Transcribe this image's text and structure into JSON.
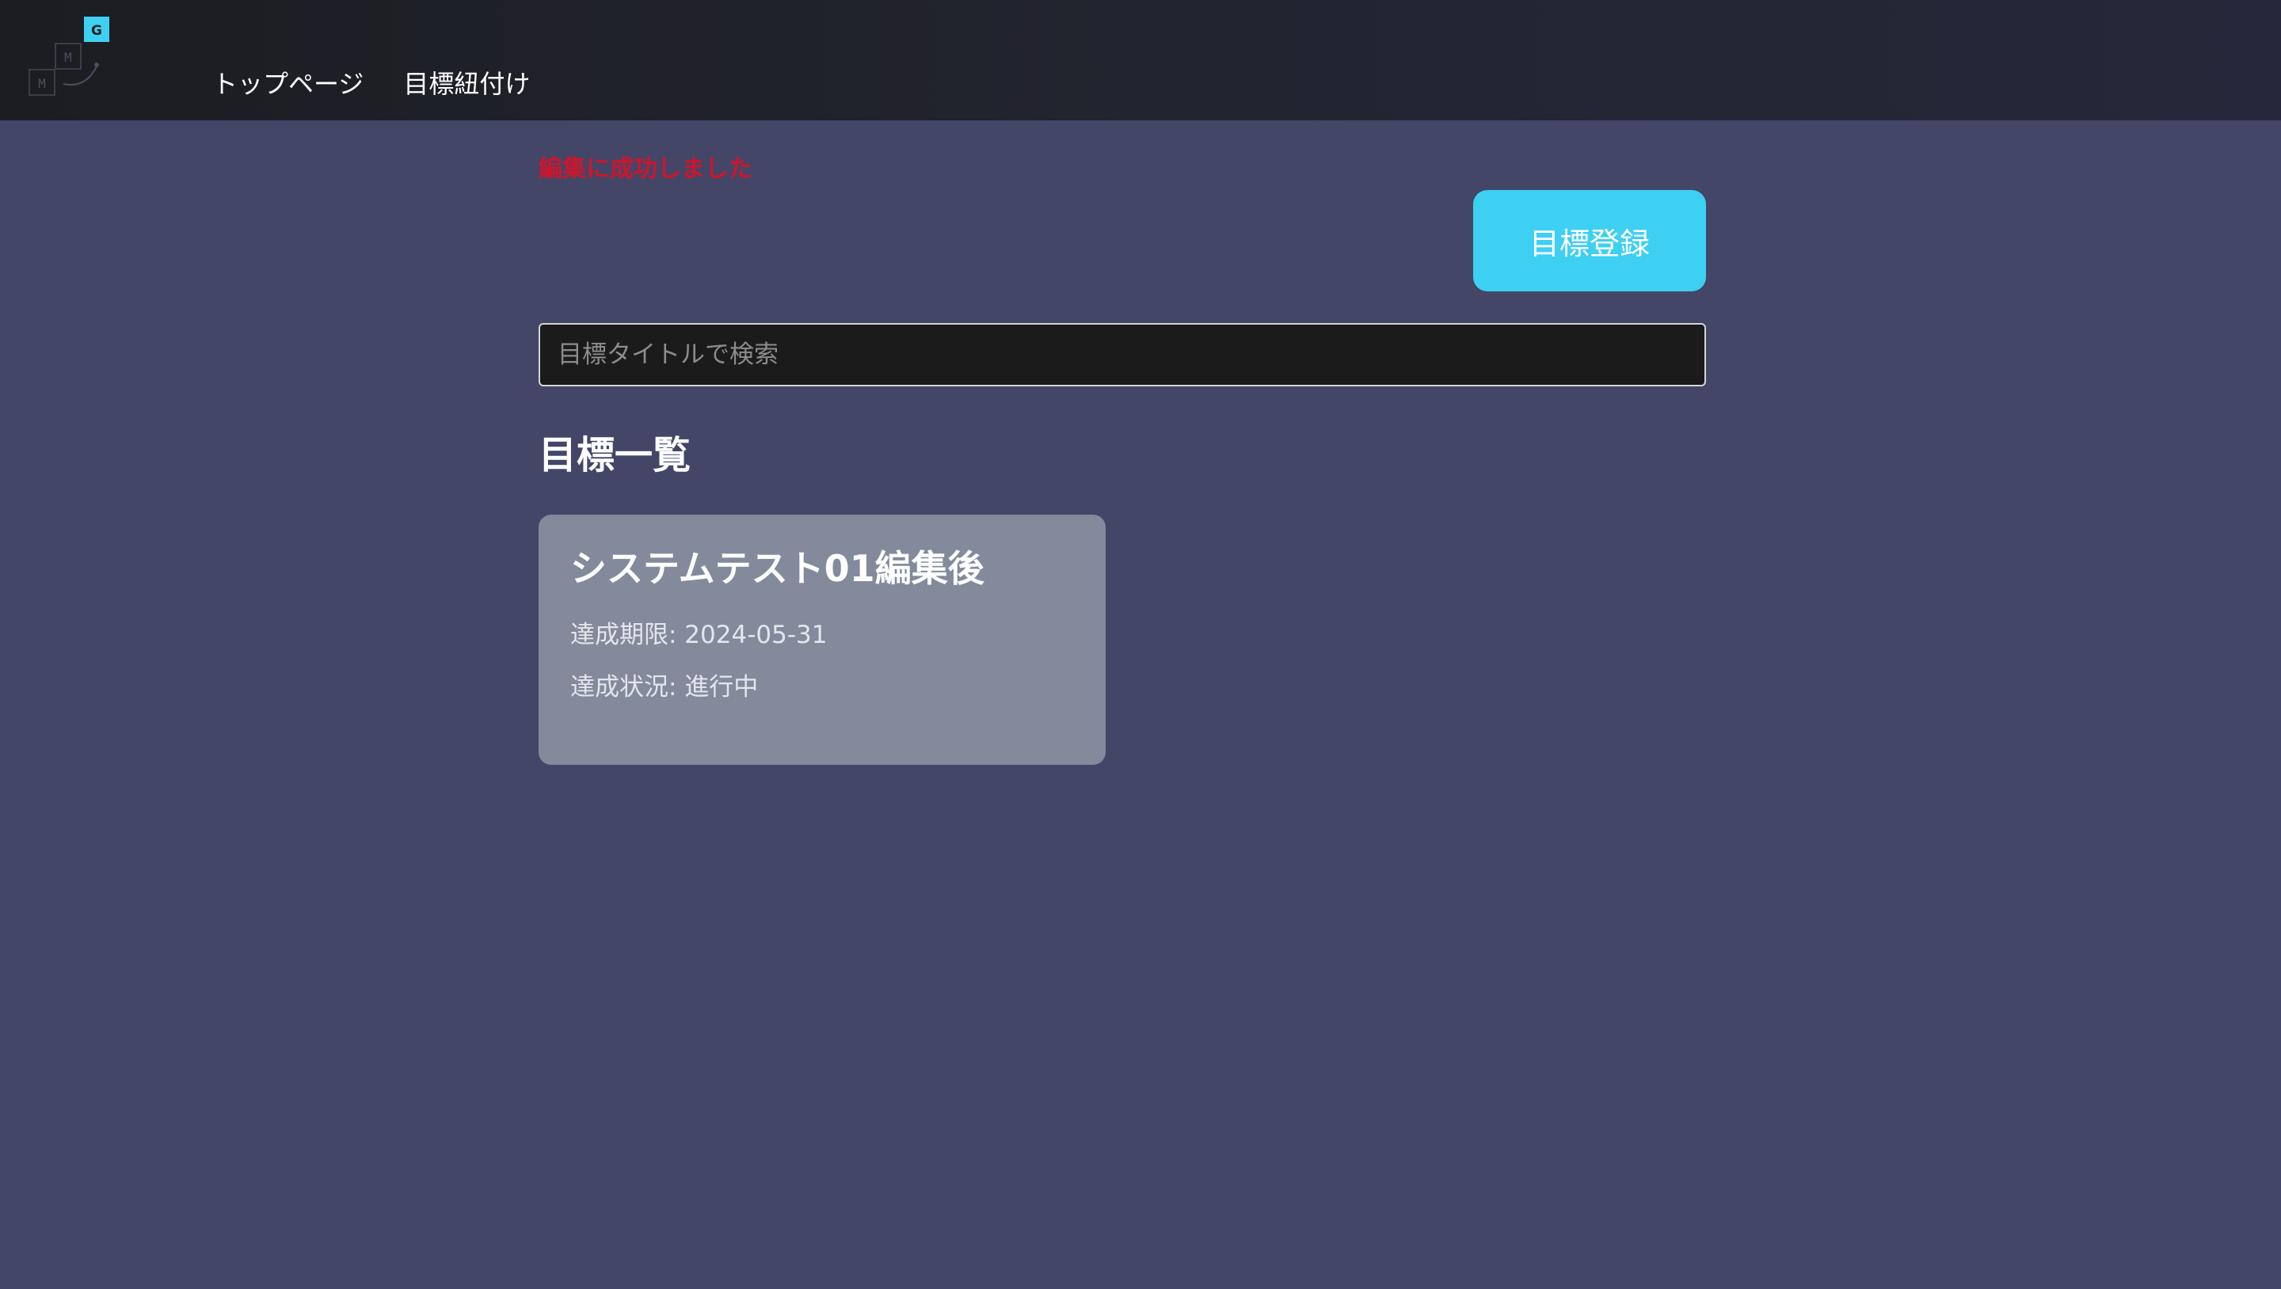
{
  "header": {
    "logo": {
      "badge_letter": "G",
      "box_letter_1": "M",
      "box_letter_2": "M",
      "accent_color": "#3dd0f2"
    },
    "nav": [
      {
        "label": "トップページ"
      },
      {
        "label": "目標紐付け"
      }
    ]
  },
  "main": {
    "message": "編集に成功しました",
    "register_button": "目標登録",
    "search": {
      "placeholder": "目標タイトルで検索",
      "value": ""
    },
    "list_title": "目標一覧",
    "goals": [
      {
        "title": "システムテスト01編集後",
        "deadline": "達成期限: 2024-05-31",
        "status": "達成状況: 進行中"
      }
    ]
  },
  "colors": {
    "background": "#434667",
    "header": "#1f2029",
    "accent": "#3dd0f2",
    "success_message": "#d0142c",
    "card": "#828a9c"
  }
}
